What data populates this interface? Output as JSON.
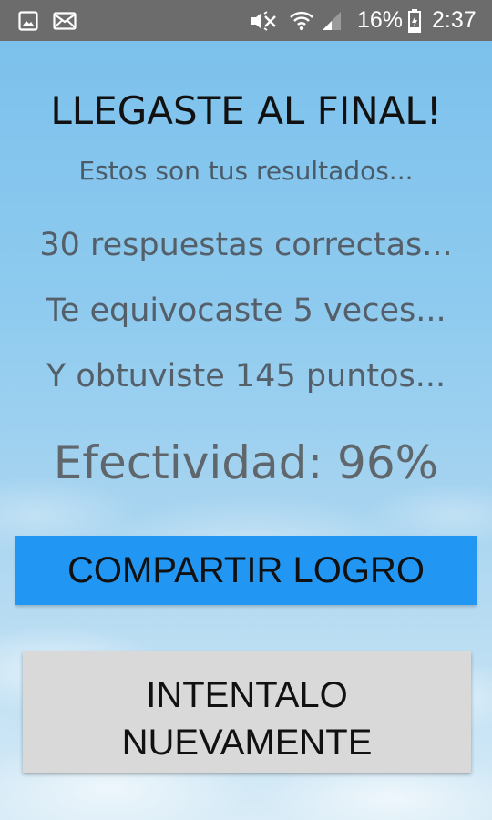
{
  "status_bar": {
    "battery": "16%",
    "time": "2:37",
    "icons": [
      "image-icon",
      "mail-icon",
      "mute-icon",
      "wifi-icon",
      "signal-icon",
      "battery-icon"
    ]
  },
  "results": {
    "title": "LLEGASTE AL FINAL!",
    "subtitle": "Estos son tus resultados...",
    "correct": "30 respuestas correctas...",
    "mistakes": "Te equivocaste 5 veces...",
    "points": "Y obtuviste 145 puntos...",
    "effectiveness": "Efectividad: 96%"
  },
  "buttons": {
    "share": "COMPARTIR LOGRO",
    "retry_line1": "INTENTALO",
    "retry_line2": "NUEVAMENTE"
  },
  "colors": {
    "status_bar": "#6c6c6c",
    "share_button": "#2196f3",
    "retry_button": "#d9d9d9",
    "sky": "#8cc6ea"
  }
}
